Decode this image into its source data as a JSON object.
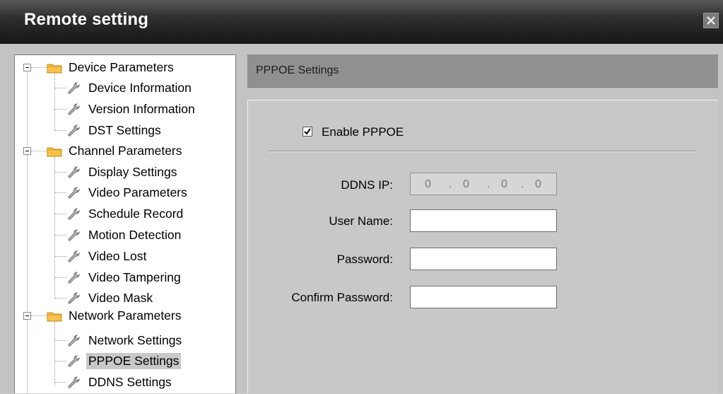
{
  "window": {
    "title": "Remote setting",
    "close_icon": "close-icon"
  },
  "tree": {
    "groups": [
      {
        "label": "Device Parameters",
        "items": [
          "Device Information",
          "Version Information",
          "DST Settings"
        ]
      },
      {
        "label": "Channel Parameters",
        "items": [
          "Display Settings",
          "Video Parameters",
          "Schedule Record",
          "Motion Detection",
          "Video Lost",
          "Video Tampering",
          "Video Mask"
        ]
      },
      {
        "label": "Network Parameters",
        "items": [
          "Network Settings",
          "PPPOE Settings",
          "DDNS Settings"
        ]
      }
    ],
    "selected": "PPPOE Settings"
  },
  "panel": {
    "header": "PPPOE Settings",
    "enable_label": "Enable PPPOE",
    "enable_checked": true,
    "ddns_ip_label": "DDNS IP:",
    "ddns_ip": [
      "0",
      "0",
      "0",
      "0"
    ],
    "user_name_label": "User Name:",
    "user_name": "",
    "password_label": "Password:",
    "password": "",
    "confirm_password_label": "Confirm Password:",
    "confirm_password": ""
  }
}
